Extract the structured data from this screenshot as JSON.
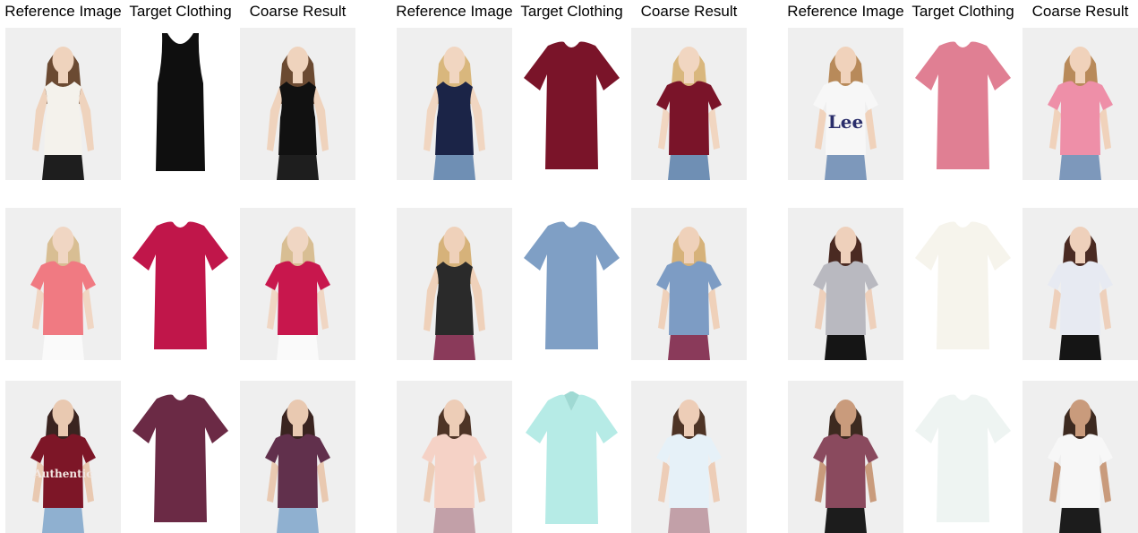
{
  "column_headers": [
    "Reference Image",
    "Target Clothing",
    "Coarse Result",
    "Reference Image",
    "Target Clothing",
    "Coarse Result",
    "Reference Image",
    "Target Clothing",
    "Coarse Result"
  ],
  "rows": [
    [
      {
        "kind": "model",
        "garment": "tank",
        "shirt": "#f4f2ec",
        "pants": "#1e1e1e",
        "hair": "#6b4a32",
        "skin": "#efd3bd"
      },
      {
        "kind": "cloth",
        "garment": "tank",
        "shirt": "#0f0f0f"
      },
      {
        "kind": "model",
        "garment": "tank",
        "shirt": "#111111",
        "pants": "#1e1e1e",
        "hair": "#6b4a32",
        "skin": "#efd3bd"
      },
      {
        "kind": "model",
        "garment": "tank",
        "shirt": "#1b2447",
        "pants": "#6f8fb4",
        "hair": "#d9b77d",
        "skin": "#f1d6c1"
      },
      {
        "kind": "cloth",
        "garment": "tee",
        "shirt": "#7a1429"
      },
      {
        "kind": "model",
        "garment": "tee",
        "shirt": "#7a1429",
        "pants": "#6f8fb4",
        "hair": "#d9b77d",
        "skin": "#f1d6c1"
      },
      {
        "kind": "model",
        "garment": "tee",
        "shirt": "#f7f7f7",
        "pants": "#7d98bb",
        "hair": "#b88a5a",
        "skin": "#f0d2bb",
        "print": "Lee",
        "print_color": "#2a2e6b"
      },
      {
        "kind": "cloth",
        "garment": "tee",
        "shirt": "#e07f93"
      },
      {
        "kind": "model",
        "garment": "tee",
        "shirt": "#ee8fa8",
        "pants": "#7d98bb",
        "hair": "#b88a5a",
        "skin": "#f0d2bb"
      }
    ],
    [
      {
        "kind": "model",
        "garment": "tee",
        "shirt": "#f07a82",
        "pants": "#fafafa",
        "hair": "#d8be93",
        "skin": "#f0d6c3"
      },
      {
        "kind": "cloth",
        "garment": "tee",
        "shirt": "#c0164a"
      },
      {
        "kind": "model",
        "garment": "tee",
        "shirt": "#c8174d",
        "pants": "#fafafa",
        "hair": "#d8be93",
        "skin": "#f0d6c3"
      },
      {
        "kind": "model",
        "garment": "tank",
        "shirt": "#2a2a2a",
        "pants": "#8a3a5a",
        "hair": "#d6b27a",
        "skin": "#efd1ba"
      },
      {
        "kind": "cloth",
        "garment": "tee",
        "shirt": "#7f9fc5"
      },
      {
        "kind": "model",
        "garment": "tee",
        "shirt": "#7d9cc4",
        "pants": "#8a3a5a",
        "hair": "#d6b27a",
        "skin": "#efd1ba"
      },
      {
        "kind": "model",
        "garment": "tee",
        "shirt": "#b9b9c0",
        "pants": "#151515",
        "hair": "#4a2a22",
        "skin": "#eed0bb"
      },
      {
        "kind": "cloth",
        "garment": "tee",
        "shirt": "#f6f4ec"
      },
      {
        "kind": "model",
        "garment": "tee",
        "shirt": "#e7eaf2",
        "pants": "#151515",
        "hair": "#4a2a22",
        "skin": "#eed0bb"
      }
    ],
    [
      {
        "kind": "model",
        "garment": "tee",
        "shirt": "#7d1627",
        "pants": "#8fb0d0",
        "hair": "#3a2420",
        "skin": "#e9c9b1",
        "print": "Authentic",
        "print_color": "#f2e7e2"
      },
      {
        "kind": "cloth",
        "garment": "tee",
        "shirt": "#6b2a45"
      },
      {
        "kind": "model",
        "garment": "tee",
        "shirt": "#61304c",
        "pants": "#8fb0d0",
        "hair": "#3a2420",
        "skin": "#e9c9b1"
      },
      {
        "kind": "model",
        "garment": "tee",
        "shirt": "#f5d2c6",
        "pants": "#c2a0a8",
        "hair": "#4e3426",
        "skin": "#edcdb7"
      },
      {
        "kind": "cloth",
        "garment": "polo",
        "shirt": "#b6ebe6"
      },
      {
        "kind": "model",
        "garment": "tee",
        "shirt": "#e6f1f8",
        "pants": "#c2a0a8",
        "hair": "#4e3426",
        "skin": "#edcdb7"
      },
      {
        "kind": "model",
        "garment": "tee",
        "shirt": "#8a4a5e",
        "pants": "#1c1c1c",
        "hair": "#3d2a20",
        "skin": "#c99b7c"
      },
      {
        "kind": "cloth",
        "garment": "tee",
        "shirt": "#eef4f2"
      },
      {
        "kind": "model",
        "garment": "tee",
        "shirt": "#f7f7f7",
        "pants": "#1c1c1c",
        "hair": "#3d2a20",
        "skin": "#c99b7c"
      }
    ]
  ]
}
